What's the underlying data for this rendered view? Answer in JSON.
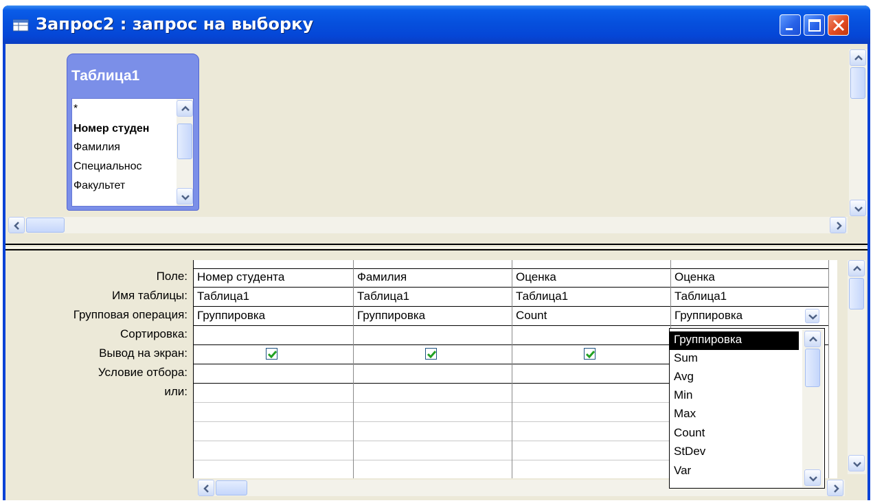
{
  "window": {
    "title": "Запрос2 : запрос на выборку",
    "minimize_icon": "minimize-icon",
    "maximize_icon": "maximize-icon",
    "close_icon": "close-icon"
  },
  "field_list": {
    "title": "Таблица1",
    "items": [
      "*",
      "Номер студен",
      "Фамилия",
      "Специальнос",
      "Факультет"
    ]
  },
  "grid": {
    "row_labels": [
      "Поле:",
      "Имя таблицы:",
      "Групповая операция:",
      "Сортировка:",
      "Вывод на экран:",
      "Условие отбора:",
      "или:"
    ],
    "columns": [
      {
        "field": "Номер студента",
        "table": "Таблица1",
        "group": "Группировка",
        "sort": "",
        "show": true
      },
      {
        "field": "Фамилия",
        "table": "Таблица1",
        "group": "Группировка",
        "sort": "",
        "show": true
      },
      {
        "field": "Оценка",
        "table": "Таблица1",
        "group": "Count",
        "sort": "",
        "show": true
      },
      {
        "field": "Оценка",
        "table": "Таблица1",
        "group": "Группировка",
        "sort": "",
        "show": null
      }
    ]
  },
  "dropdown": {
    "selected": "Группировка",
    "options": [
      "Группировка",
      "Sum",
      "Avg",
      "Min",
      "Max",
      "Count",
      "StDev",
      "Var"
    ]
  },
  "colors": {
    "title_bar": "#0650dd",
    "field_list_header": "#7b8fe8",
    "client_bg": "#ece9d8",
    "checkbox_check": "#21a121",
    "close_button": "#e24b22"
  }
}
